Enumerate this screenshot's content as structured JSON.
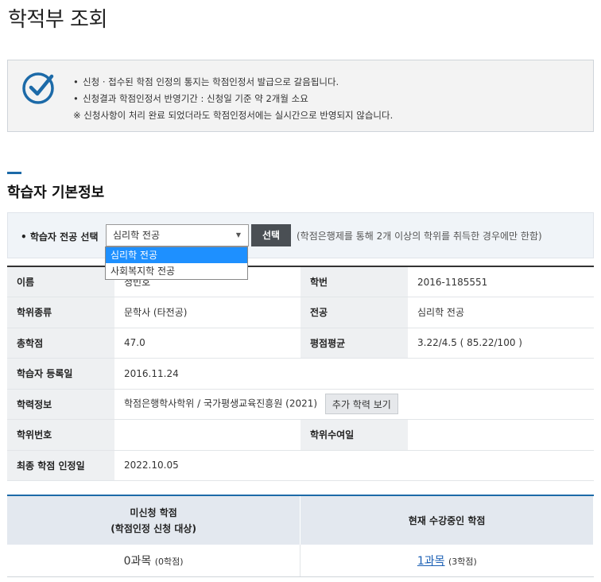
{
  "page_title": "학적부 조회",
  "notice": {
    "lines": [
      "신청 · 접수된 학점 인정의 통지는 학점인정서 발급으로 갈음됩니다.",
      "신청결과 학점인정서 반영기간 : 신청일 기준 약 2개월 소요",
      "※ 신청사항이 처리 완료 되었더라도 학점인정서에는 실시간으로 반영되지 않습니다."
    ],
    "bullet": "•",
    "icon_color": "#1c6aa8"
  },
  "section_title": "학습자 기본정보",
  "major_select": {
    "label": "• 학습자 전공 선택",
    "selected": "심리학 전공",
    "options": [
      "심리학 전공",
      "사회복지학 전공"
    ],
    "button": "선택",
    "note": "(학점은행제를 통해 2개 이상의 학위를 취득한 경우에만 한함)"
  },
  "info": {
    "name_label": "이름",
    "name_value": "정빈호",
    "student_no_label": "학번",
    "student_no_value": "2016-1185551",
    "degree_type_label": "학위종류",
    "degree_type_value": "문학사 (타전공)",
    "major_label": "전공",
    "major_value": "심리학 전공",
    "total_credits_label": "총학점",
    "total_credits_value": "47.0",
    "gpa_label": "평점평균",
    "gpa_value": "3.22/4.5 ( 85.22/100 )",
    "reg_date_label": "학습자 등록일",
    "reg_date_value": "2016.11.24",
    "edu_label": "학력정보",
    "edu_value": "학점은행학사학위 / 국가평생교육진흥원 (2021)",
    "edu_more_button": "추가 학력 보기",
    "degree_no_label": "학위번호",
    "degree_no_value": "",
    "degree_date_label": "학위수여일",
    "degree_date_value": "",
    "final_date_label": "최종 학점 인정일",
    "final_date_value": "2022.10.05"
  },
  "credits": {
    "col1_header_line1": "미신청 학점",
    "col1_header_line2": "(학점인정 신청 대상)",
    "col2_header": "현재 수강중인 학점",
    "col1_value": "0과목",
    "col1_sub": "(0학점)",
    "col2_value": "1과목",
    "col2_sub": "(3학점)"
  }
}
